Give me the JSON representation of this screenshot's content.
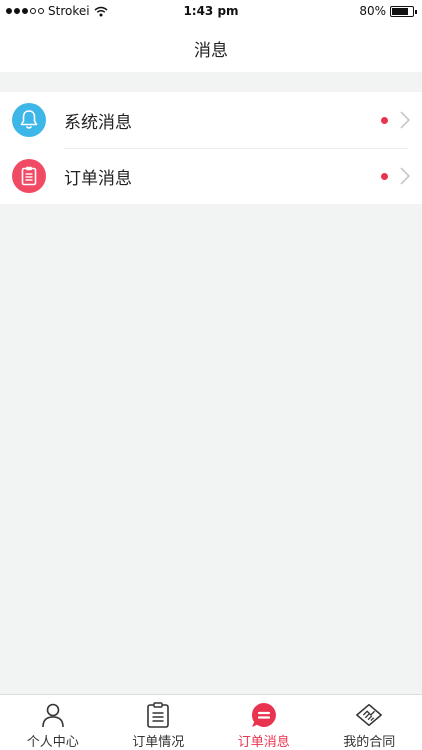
{
  "status_bar": {
    "carrier": "Strokei",
    "time": "1:43 pm",
    "battery": "80%",
    "battery_level": 0.8,
    "signal_filled": 3,
    "signal_total": 5
  },
  "header": {
    "title": "消息"
  },
  "list": {
    "items": [
      {
        "label": "系统消息",
        "icon": "bell-icon",
        "icon_color": "#3db6e8",
        "unread": true
      },
      {
        "label": "订单消息",
        "icon": "clipboard-icon",
        "icon_color": "#f04a64",
        "unread": true
      }
    ],
    "unread_dot_color": "#e8344f"
  },
  "tab_bar": {
    "active_index": 2,
    "active_color": "#e8344f",
    "items": [
      {
        "label": "个人中心",
        "icon": "person-icon"
      },
      {
        "label": "订单情况",
        "icon": "clipboard-list-icon"
      },
      {
        "label": "订单消息",
        "icon": "chat-bubble-icon"
      },
      {
        "label": "我的合同",
        "icon": "handshake-icon"
      }
    ]
  }
}
